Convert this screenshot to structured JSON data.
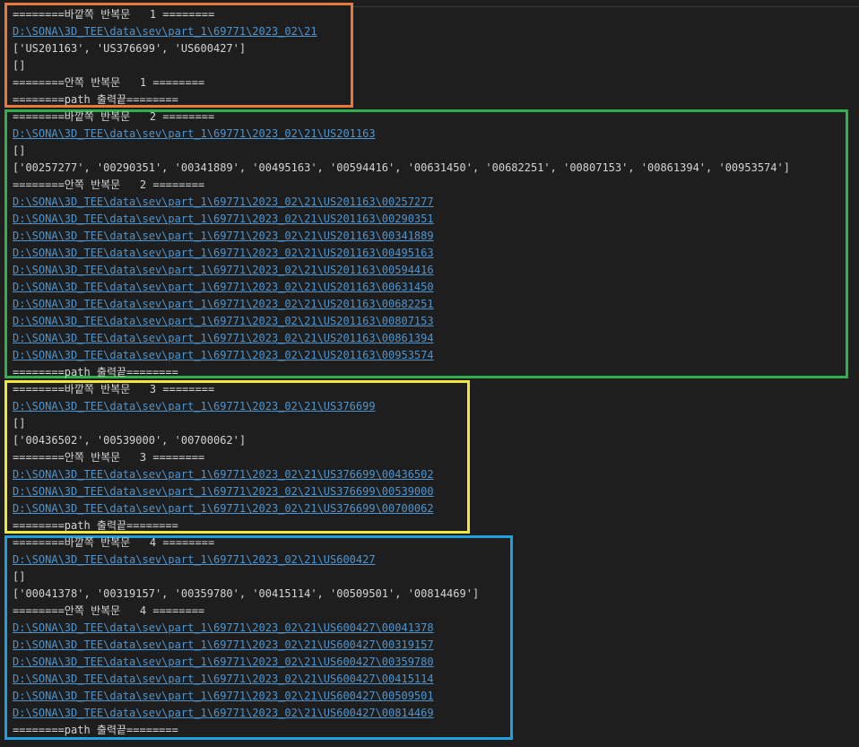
{
  "colors": {
    "background": "#1e1e1e",
    "text": "#d4d4d4",
    "link": "#4e94ce",
    "box_orange": "#e8793a",
    "box_green": "#2fb04b",
    "box_yellow": "#f0e63c",
    "box_blue": "#1fa0e0"
  },
  "blocks": [
    {
      "box_color": "orange",
      "lines": [
        {
          "text": "========바깥쪽 반복문   1 ========",
          "link": false
        },
        {
          "text": "D:\\SONA\\3D_TEE\\data\\sev\\part_1\\69771\\2023_02\\21",
          "link": true
        },
        {
          "text": "['US201163', 'US376699', 'US600427']",
          "link": false
        },
        {
          "text": "[]",
          "link": false
        },
        {
          "text": "========안쪽 반복문   1 ========",
          "link": false
        },
        {
          "text": "========path 출력끝========",
          "link": false
        }
      ]
    },
    {
      "box_color": "green",
      "lines": [
        {
          "text": "========바깥쪽 반복문   2 ========",
          "link": false
        },
        {
          "text": "D:\\SONA\\3D_TEE\\data\\sev\\part_1\\69771\\2023_02\\21\\US201163",
          "link": true
        },
        {
          "text": "[]",
          "link": false
        },
        {
          "text": "['00257277', '00290351', '00341889', '00495163', '00594416', '00631450', '00682251', '00807153', '00861394', '00953574']",
          "link": false
        },
        {
          "text": "========안쪽 반복문   2 ========",
          "link": false
        },
        {
          "text": "D:\\SONA\\3D_TEE\\data\\sev\\part_1\\69771\\2023_02\\21\\US201163\\00257277",
          "link": true
        },
        {
          "text": "D:\\SONA\\3D_TEE\\data\\sev\\part_1\\69771\\2023_02\\21\\US201163\\00290351",
          "link": true
        },
        {
          "text": "D:\\SONA\\3D_TEE\\data\\sev\\part_1\\69771\\2023_02\\21\\US201163\\00341889",
          "link": true
        },
        {
          "text": "D:\\SONA\\3D_TEE\\data\\sev\\part_1\\69771\\2023_02\\21\\US201163\\00495163",
          "link": true
        },
        {
          "text": "D:\\SONA\\3D_TEE\\data\\sev\\part_1\\69771\\2023_02\\21\\US201163\\00594416",
          "link": true
        },
        {
          "text": "D:\\SONA\\3D_TEE\\data\\sev\\part_1\\69771\\2023_02\\21\\US201163\\00631450",
          "link": true
        },
        {
          "text": "D:\\SONA\\3D_TEE\\data\\sev\\part_1\\69771\\2023_02\\21\\US201163\\00682251",
          "link": true
        },
        {
          "text": "D:\\SONA\\3D_TEE\\data\\sev\\part_1\\69771\\2023_02\\21\\US201163\\00807153",
          "link": true
        },
        {
          "text": "D:\\SONA\\3D_TEE\\data\\sev\\part_1\\69771\\2023_02\\21\\US201163\\00861394",
          "link": true
        },
        {
          "text": "D:\\SONA\\3D_TEE\\data\\sev\\part_1\\69771\\2023_02\\21\\US201163\\00953574",
          "link": true
        },
        {
          "text": "========path 출력끝========",
          "link": false
        }
      ]
    },
    {
      "box_color": "yellow",
      "lines": [
        {
          "text": "========바깥쪽 반복문   3 ========",
          "link": false
        },
        {
          "text": "D:\\SONA\\3D_TEE\\data\\sev\\part_1\\69771\\2023_02\\21\\US376699",
          "link": true
        },
        {
          "text": "[]",
          "link": false
        },
        {
          "text": "['00436502', '00539000', '00700062']",
          "link": false
        },
        {
          "text": "========안쪽 반복문   3 ========",
          "link": false
        },
        {
          "text": "D:\\SONA\\3D_TEE\\data\\sev\\part_1\\69771\\2023_02\\21\\US376699\\00436502",
          "link": true
        },
        {
          "text": "D:\\SONA\\3D_TEE\\data\\sev\\part_1\\69771\\2023_02\\21\\US376699\\00539000",
          "link": true
        },
        {
          "text": "D:\\SONA\\3D_TEE\\data\\sev\\part_1\\69771\\2023_02\\21\\US376699\\00700062",
          "link": true
        },
        {
          "text": "========path 출력끝========",
          "link": false
        }
      ]
    },
    {
      "box_color": "blue",
      "lines": [
        {
          "text": "========바깥쪽 반복문   4 ========",
          "link": false
        },
        {
          "text": "D:\\SONA\\3D_TEE\\data\\sev\\part_1\\69771\\2023_02\\21\\US600427",
          "link": true
        },
        {
          "text": "[]",
          "link": false
        },
        {
          "text": "['00041378', '00319157', '00359780', '00415114', '00509501', '00814469']",
          "link": false
        },
        {
          "text": "========안쪽 반복문   4 ========",
          "link": false
        },
        {
          "text": "D:\\SONA\\3D_TEE\\data\\sev\\part_1\\69771\\2023_02\\21\\US600427\\00041378",
          "link": true
        },
        {
          "text": "D:\\SONA\\3D_TEE\\data\\sev\\part_1\\69771\\2023_02\\21\\US600427\\00319157",
          "link": true
        },
        {
          "text": "D:\\SONA\\3D_TEE\\data\\sev\\part_1\\69771\\2023_02\\21\\US600427\\00359780",
          "link": true
        },
        {
          "text": "D:\\SONA\\3D_TEE\\data\\sev\\part_1\\69771\\2023_02\\21\\US600427\\00415114",
          "link": true
        },
        {
          "text": "D:\\SONA\\3D_TEE\\data\\sev\\part_1\\69771\\2023_02\\21\\US600427\\00509501",
          "link": true
        },
        {
          "text": "D:\\SONA\\3D_TEE\\data\\sev\\part_1\\69771\\2023_02\\21\\US600427\\00814469",
          "link": true
        },
        {
          "text": "========path 출력끝========",
          "link": false
        }
      ]
    }
  ]
}
